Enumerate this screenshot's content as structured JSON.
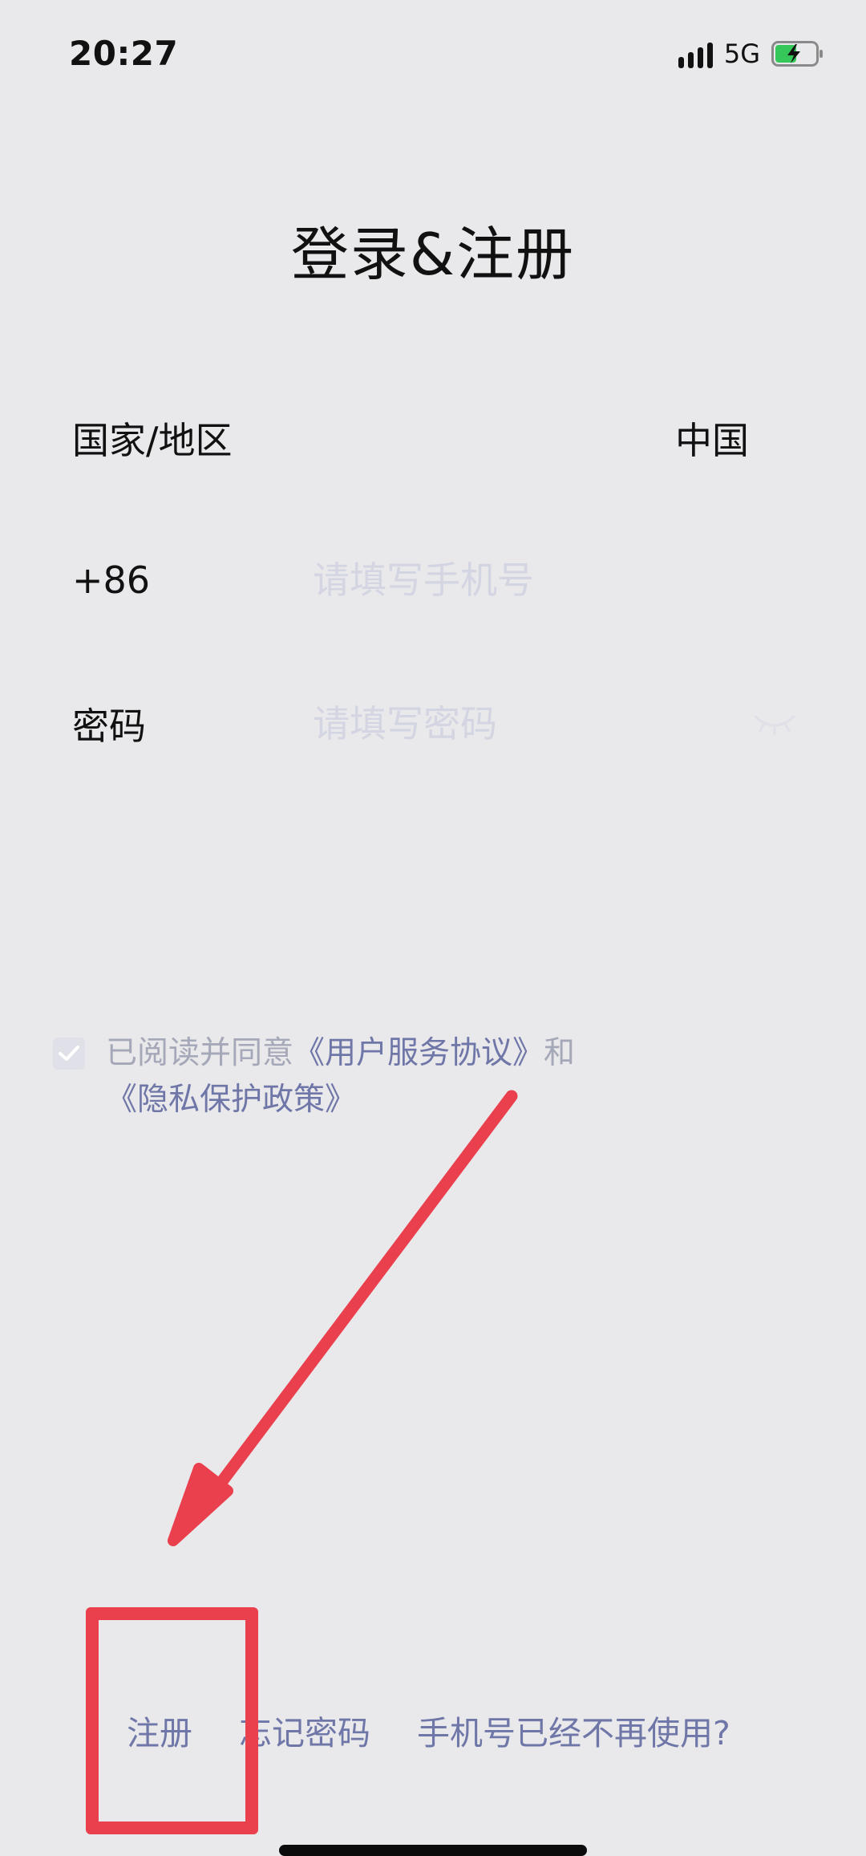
{
  "status_bar": {
    "time": "20:27",
    "network": "5G"
  },
  "title": "登录&注册",
  "form": {
    "region": {
      "label": "国家/地区",
      "value": "中国"
    },
    "phone": {
      "label": "+86",
      "placeholder": "请填写手机号"
    },
    "password": {
      "label": "密码",
      "placeholder": "请填写密码"
    }
  },
  "agreement": {
    "prefix": "已阅读并同意",
    "service_link": "《用户服务协议》",
    "and": "和",
    "privacy_link": "《隐私保护政策》",
    "checked": true
  },
  "bottom_links": {
    "register": "注册",
    "forgot_password": "忘记密码",
    "phone_unused": "手机号已经不再使用?"
  },
  "colors": {
    "background": "#e9e8ea",
    "link": "#6f76a8",
    "annotation": "#ea3f4c",
    "placeholder": "#d3d5e2"
  }
}
